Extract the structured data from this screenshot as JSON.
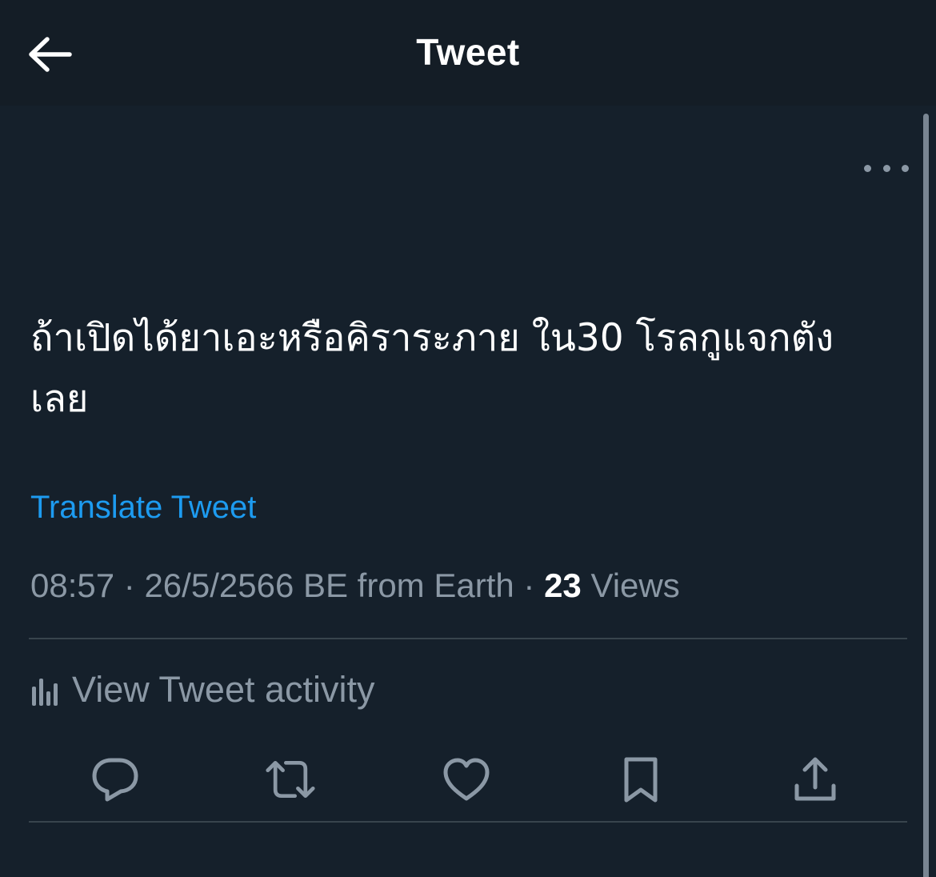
{
  "header": {
    "title": "Tweet",
    "back_icon": "arrow-left-icon"
  },
  "tweet": {
    "text": "ถ้าเปิดได้ยาเอะหรือคิราระภาย ใน30 โรลกูแจกตัง\nเลย",
    "translate_label": "Translate Tweet",
    "time": "08:57",
    "date": "26/5/2566 BE",
    "source": "from Earth",
    "separator": "·",
    "views_count": "23",
    "views_label": "Views"
  },
  "activity": {
    "label": "View Tweet activity",
    "icon": "bar-chart-icon"
  },
  "actions": {
    "reply": "reply-icon",
    "retweet": "retweet-icon",
    "like": "heart-icon",
    "bookmark": "bookmark-icon",
    "share": "share-icon"
  },
  "colors": {
    "background": "#15202b",
    "header_background": "#141d26",
    "accent": "#1d9bf0",
    "secondary_text": "#8b98a5",
    "divider": "#38444d"
  }
}
